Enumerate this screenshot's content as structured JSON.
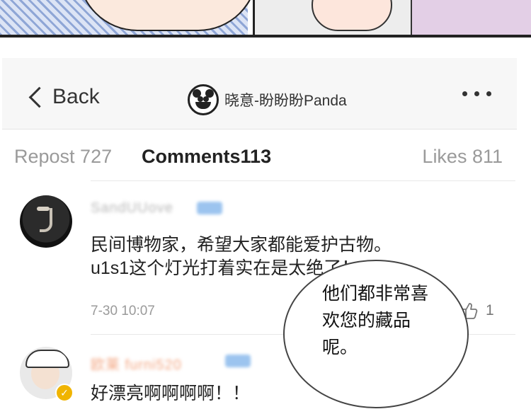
{
  "navbar": {
    "back_label": "Back",
    "title": "晓意-盼盼盼Panda"
  },
  "tabs": {
    "repost": "Repost 727",
    "comments": "Comments113",
    "likes": "Likes 811"
  },
  "comments": [
    {
      "username": "SandUUove",
      "text_line1": "民间博物家，希望大家都能爱护古物。",
      "text_line2": "u1s1这个灯光打着实在是太绝了！",
      "time": "7-30 10:07",
      "likes": "1"
    },
    {
      "username": "欧莱 furni520",
      "text_line1": "好漂亮啊啊啊啊！！"
    }
  ],
  "speech_bubble": {
    "text": "他们都非常喜欢您的藏品呢。"
  },
  "colors": {
    "accent_blue": "#9cc4ef",
    "verified_gold": "#f0b400"
  }
}
